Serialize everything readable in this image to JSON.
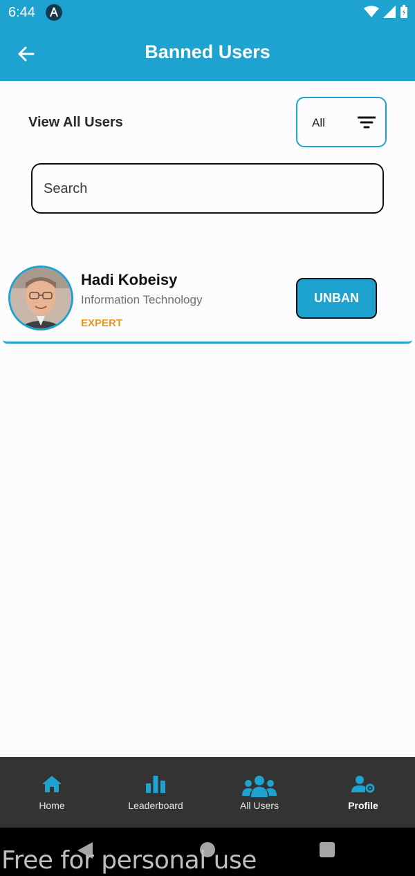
{
  "status_bar": {
    "time": "6:44"
  },
  "app_bar": {
    "title": "Banned Users"
  },
  "filter_section": {
    "title": "View All Users",
    "filter_value": "All"
  },
  "search": {
    "placeholder": "Search",
    "value": ""
  },
  "users": [
    {
      "name": "Hadi Kobeisy",
      "department": "Information Technology",
      "role": "EXPERT",
      "action_label": "UNBAN"
    }
  ],
  "bottom_nav": {
    "items": [
      {
        "label": "Home",
        "icon": "home-icon"
      },
      {
        "label": "Leaderboard",
        "icon": "bar-chart-icon"
      },
      {
        "label": "All Users",
        "icon": "users-group-icon"
      },
      {
        "label": "Profile",
        "icon": "user-gear-icon",
        "active": true
      }
    ]
  },
  "watermark": "Free for personal use",
  "colors": {
    "primary": "#1ea3d1",
    "accent": "#e39a1c",
    "nav_background": "#333333"
  }
}
